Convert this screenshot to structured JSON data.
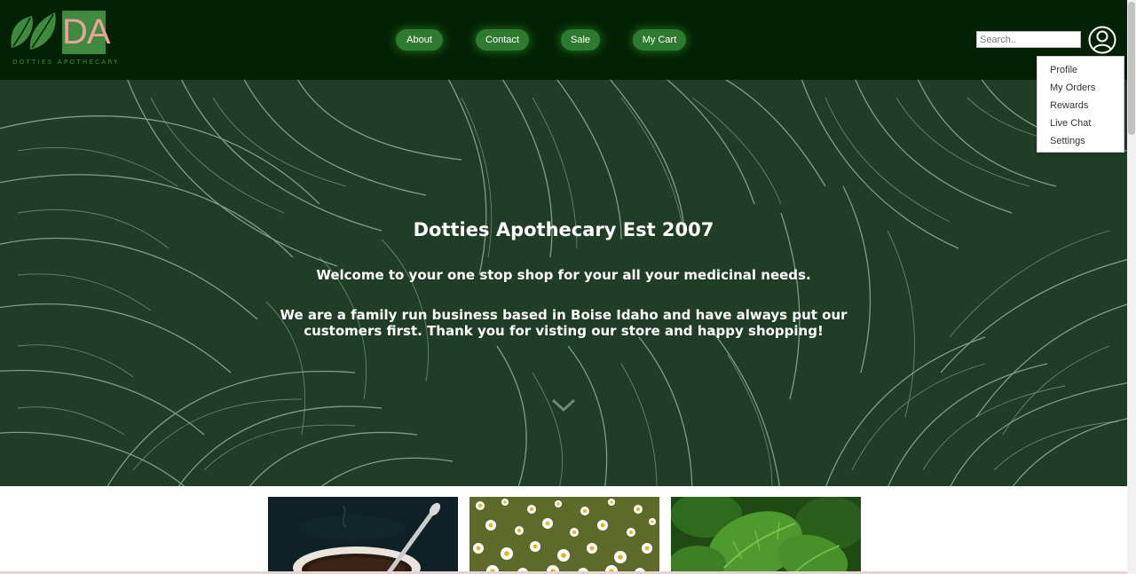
{
  "brand": {
    "logo_letters": "DA",
    "logo_text": "DOTTIES APOTHECARY"
  },
  "nav": {
    "items": [
      {
        "label": "About"
      },
      {
        "label": "Contact"
      },
      {
        "label": "Sale"
      },
      {
        "label": "My Cart"
      }
    ]
  },
  "search": {
    "placeholder": "Search..",
    "value": ""
  },
  "account_menu": {
    "icon": "user-circle-icon",
    "items": [
      {
        "label": "Profile"
      },
      {
        "label": "My Orders"
      },
      {
        "label": "Rewards"
      },
      {
        "label": "Live Chat"
      },
      {
        "label": "Settings"
      }
    ]
  },
  "hero": {
    "title": "Dotties Apothecary Est 2007",
    "welcome": "Welcome to your one stop shop for your all your medicinal needs.",
    "description": "We are a family run business based in Boise Idaho and have always put our customers first. Thank you for visting our store and happy shopping!",
    "scroll_icon": "chevron-down-icon"
  },
  "products": [
    {
      "image": "tea-cup-image"
    },
    {
      "image": "chamomile-flowers-image"
    },
    {
      "image": "mint-leaves-image"
    }
  ],
  "colors": {
    "header_bg": "#032203",
    "nav_button": "#2e7a2e",
    "hero_bg": "#1f3d27",
    "logo_pink": "#e8a49a",
    "logo_green": "#3f8a3f"
  }
}
